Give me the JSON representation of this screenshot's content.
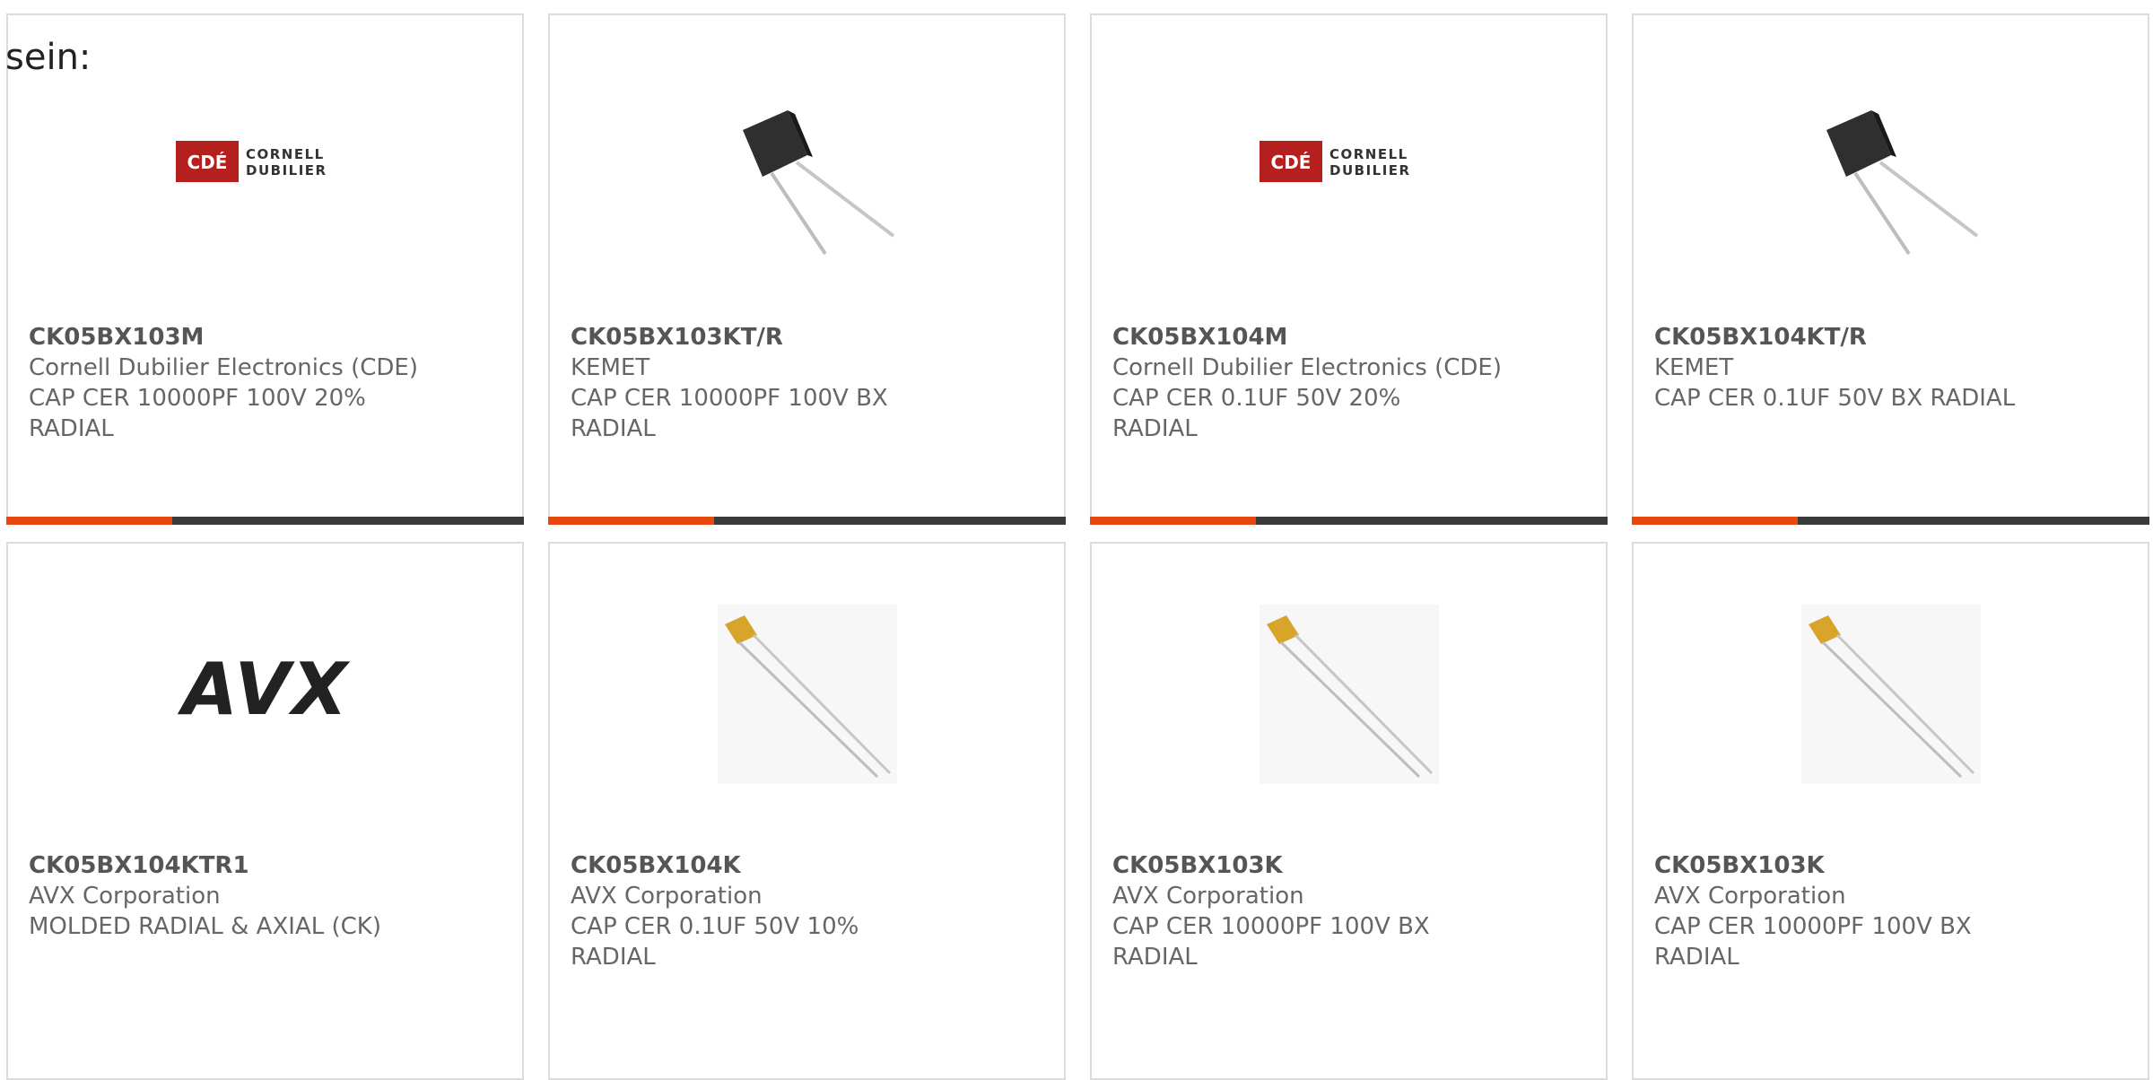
{
  "heading": "sein:",
  "colors": {
    "accent": "#e8470f",
    "bar_track": "#3a3a3a",
    "card_border": "#dcdcdc"
  },
  "cards": [
    {
      "part": "CK05BX103M",
      "manufacturer": "Cornell Dubilier Electronics (CDE)",
      "description": "CAP CER 10000PF 100V 20% RADIAL",
      "image": "cde-logo",
      "logo_text": [
        "CDÉ",
        "CORNELL",
        "DUBILIER"
      ],
      "bar_fill": 0.32
    },
    {
      "part": "CK05BX103KT/R",
      "manufacturer": "KEMET",
      "description": "CAP CER 10000PF 100V BX RADIAL",
      "image": "black-radial-capacitor",
      "bar_fill": 0.32
    },
    {
      "part": "CK05BX104M",
      "manufacturer": "Cornell Dubilier Electronics (CDE)",
      "description": "CAP CER 0.1UF 50V 20% RADIAL",
      "image": "cde-logo",
      "logo_text": [
        "CDÉ",
        "CORNELL",
        "DUBILIER"
      ],
      "bar_fill": 0.32
    },
    {
      "part": "CK05BX104KT/R",
      "manufacturer": "KEMET",
      "description": "CAP CER 0.1UF 50V BX RADIAL",
      "image": "black-radial-capacitor",
      "bar_fill": 0.32
    },
    {
      "part": "CK05BX104KTR1",
      "manufacturer": "AVX Corporation",
      "description": "MOLDED RADIAL & AXIAL (CK)",
      "image": "avx-logo",
      "logo_text": [
        "AVX"
      ]
    },
    {
      "part": "CK05BX104K",
      "manufacturer": "AVX Corporation",
      "description": "CAP CER 0.1UF 50V 10% RADIAL",
      "image": "yellow-radial-capacitor"
    },
    {
      "part": "CK05BX103K",
      "manufacturer": "AVX Corporation",
      "description": "CAP CER 10000PF 100V BX RADIAL",
      "image": "yellow-radial-capacitor"
    },
    {
      "part": "CK05BX103K",
      "manufacturer": "AVX Corporation",
      "description": "CAP CER 10000PF 100V BX RADIAL",
      "image": "yellow-radial-capacitor"
    }
  ]
}
